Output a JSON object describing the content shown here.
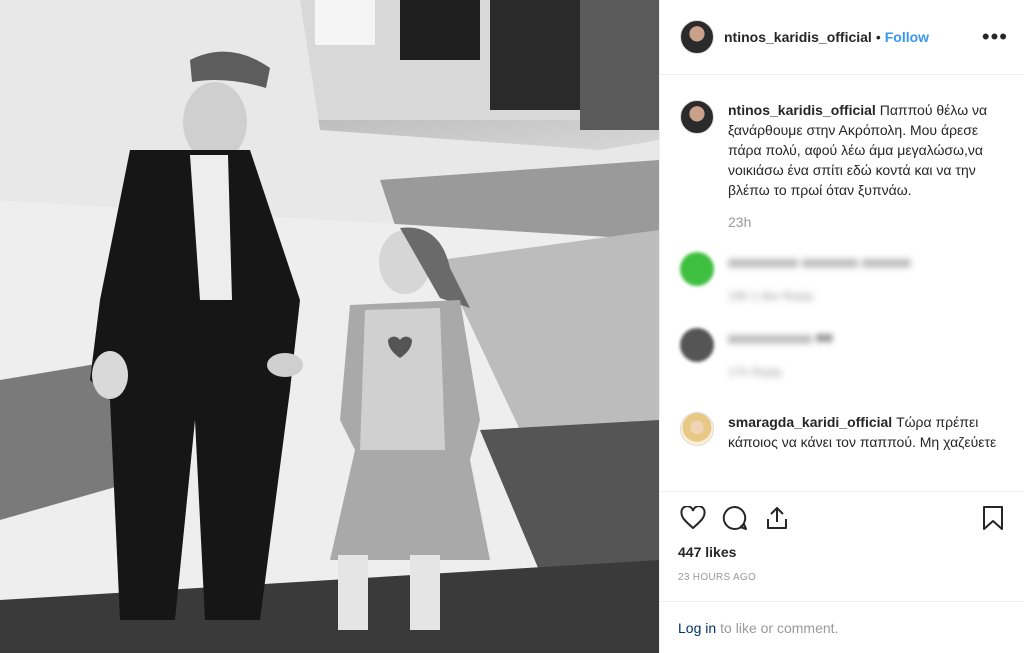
{
  "header": {
    "username": "ntinos_karidis_official",
    "separator": "•",
    "follow_label": "Follow",
    "more_label": "•••"
  },
  "caption": {
    "username": "ntinos_karidis_official",
    "text": "Παππού θέλω να ξανάρθουμε στην Ακρόπολη. Μου άρεσε πάρα πολύ, αφού λέω άμα μεγαλώσω,να νοικιάσω ένα σπίτι εδώ κοντά και να την βλέπω το πρωί όταν ξυπνάω.",
    "time": "23h"
  },
  "blurred_comments": [
    {
      "text": "xxxxxxxxxx xxxxxxxx xxxxxxx",
      "meta": "19h  1 like  Reply"
    },
    {
      "text": "xxxxxxxxxxxx ♥♥",
      "meta": "17h  Reply"
    }
  ],
  "last_comment": {
    "username": "smaragda_karidi_official",
    "text": "Τώρα πρέπει κάποιος να κάνει τον παππού. Μη χαζεύετε"
  },
  "actions": {
    "likes": "447 likes",
    "posted": "23 HOURS AGO",
    "login_link": "Log in",
    "login_text": "to like or comment."
  },
  "icons": [
    "heart-icon",
    "comment-icon",
    "share-icon",
    "bookmark-icon",
    "more-icon"
  ],
  "colors": {
    "accent": "#3897f0",
    "link": "#003569",
    "muted": "#999999",
    "border": "#efefef"
  }
}
